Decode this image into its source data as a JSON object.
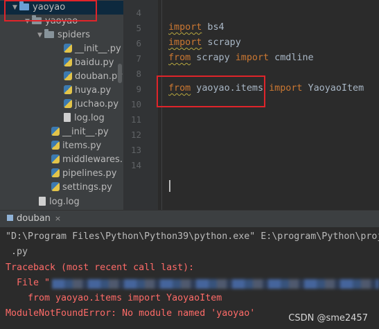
{
  "project_tree": {
    "root": "yaoyao",
    "package": "yaoyao",
    "spiders_folder": "spiders",
    "spider_files": [
      "__init__.py",
      "baidu.py",
      "douban.py",
      "huya.py",
      "juchao.py",
      "log.log"
    ],
    "package_files": [
      "__init__.py",
      "items.py",
      "middlewares.py",
      "pipelines.py",
      "settings.py"
    ],
    "root_files": [
      "log.log"
    ]
  },
  "editor": {
    "line_numbers": [
      "4",
      "5",
      "6",
      "7",
      "8",
      "9",
      "10",
      "11",
      "12",
      "13",
      "14"
    ],
    "lines": {
      "l5_kw": "import",
      "l5_rest": " bs4",
      "l6_kw": "import",
      "l6_rest": " scrapy",
      "l7_kw1": "from",
      "l7_mid": " scrapy ",
      "l7_kw2": "import",
      "l7_rest": " cmdline",
      "l9_kw1": "from",
      "l9_mid": " yaoyao.items ",
      "l9_kw2": "import",
      "l9_rest": " YaoyaoItem"
    }
  },
  "run_panel": {
    "tab_label": "douban",
    "close_glyph": "×",
    "console_lines": [
      "\"D:\\Program Files\\Python\\Python39\\python.exe\" E:\\program\\Python\\proj",
      " .py",
      "Traceback (most recent call last):",
      "  File \"",
      "    from yaoyao.items import YaoyaoItem",
      "ModuleNotFoundError: No module named 'yaoyao'"
    ]
  },
  "watermark": "CSDN @sme2457",
  "colors": {
    "keyword": "#cc7832",
    "error": "#ff6b68",
    "highlight_box": "#e0242a"
  }
}
